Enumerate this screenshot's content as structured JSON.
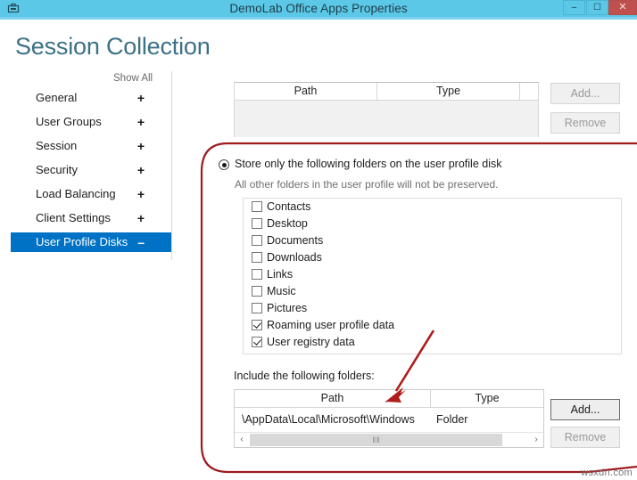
{
  "window": {
    "title": "DemoLab Office Apps Properties",
    "icon": "app-icon",
    "minimize_label": "–",
    "maximize_label": "☐",
    "close_label": "✕"
  },
  "page": {
    "title": "Session Collection",
    "show_all_label": "Show All"
  },
  "sidebar": {
    "items": [
      {
        "label": "General",
        "sign": "+",
        "selected": false
      },
      {
        "label": "User Groups",
        "sign": "+",
        "selected": false
      },
      {
        "label": "Session",
        "sign": "+",
        "selected": false
      },
      {
        "label": "Security",
        "sign": "+",
        "selected": false
      },
      {
        "label": "Load Balancing",
        "sign": "+",
        "selected": false
      },
      {
        "label": "Client Settings",
        "sign": "+",
        "selected": false
      },
      {
        "label": "User Profile Disks",
        "sign": "–",
        "selected": true
      }
    ]
  },
  "top_grid": {
    "columns": [
      "Path",
      "Type"
    ],
    "rows": [],
    "add_label": "Add...",
    "remove_label": "Remove",
    "add_enabled": false,
    "remove_enabled": false
  },
  "profile_disk": {
    "radio_label": "Store only the following folders on the user profile disk",
    "radio_selected": true,
    "sub_label": "All other folders in the user profile will not be preserved.",
    "folders": [
      {
        "label": "Contacts",
        "checked": false
      },
      {
        "label": "Desktop",
        "checked": false
      },
      {
        "label": "Documents",
        "checked": false
      },
      {
        "label": "Downloads",
        "checked": false
      },
      {
        "label": "Links",
        "checked": false
      },
      {
        "label": "Music",
        "checked": false
      },
      {
        "label": "Pictures",
        "checked": false
      },
      {
        "label": "Roaming user profile data",
        "checked": true
      },
      {
        "label": "User registry data",
        "checked": true
      }
    ]
  },
  "include_folders": {
    "label": "Include the following folders:",
    "columns": [
      "Path",
      "Type"
    ],
    "rows": [
      {
        "path": "\\AppData\\Local\\Microsoft\\Windows",
        "type": "Folder"
      }
    ],
    "add_label": "Add...",
    "remove_label": "Remove",
    "add_enabled": true,
    "remove_enabled": false,
    "scroll_left_glyph": "‹",
    "scroll_right_glyph": "›",
    "scroll_grip_glyph": "‖‖"
  },
  "annotations": {
    "highlight_color": "#9e1b20",
    "arrow_color": "#b01c1c",
    "watermark": "wsxdn.com"
  }
}
